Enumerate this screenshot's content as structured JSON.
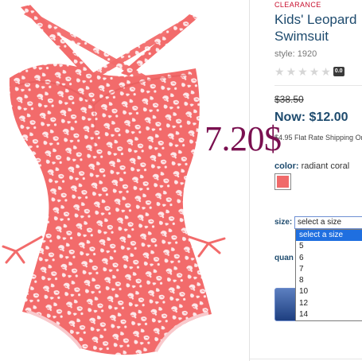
{
  "product": {
    "badge": "CLEARANCE",
    "title_line1": "Kids' Leopard",
    "title_line2": "Swimsuit",
    "style": "style: 1920",
    "rating": {
      "stars_filled": 0,
      "stars_total": 5,
      "badge": "0.0"
    },
    "was_price": "$38.50",
    "now_price": "Now: $12.00",
    "shipping": "$4.95 Flat Rate Shipping On",
    "overlay_price": "7.20$"
  },
  "color": {
    "label": "color:",
    "value": "radiant coral",
    "swatch_color": "#f06a6a"
  },
  "size": {
    "label": "size:",
    "selected": "select a size",
    "options": [
      "select a size",
      "5",
      "6",
      "7",
      "8",
      "10",
      "12",
      "14"
    ]
  },
  "quantity": {
    "label": "quan"
  },
  "colors": {
    "accent": "#1e4b6e",
    "clearance": "#c8102e",
    "overlay": "#7a1050",
    "dropdown_highlight": "#1f6fe0",
    "swimsuit": "#f26b6b"
  },
  "icons": {
    "star": "star-icon",
    "product_image": "leopard-swimsuit-image"
  }
}
